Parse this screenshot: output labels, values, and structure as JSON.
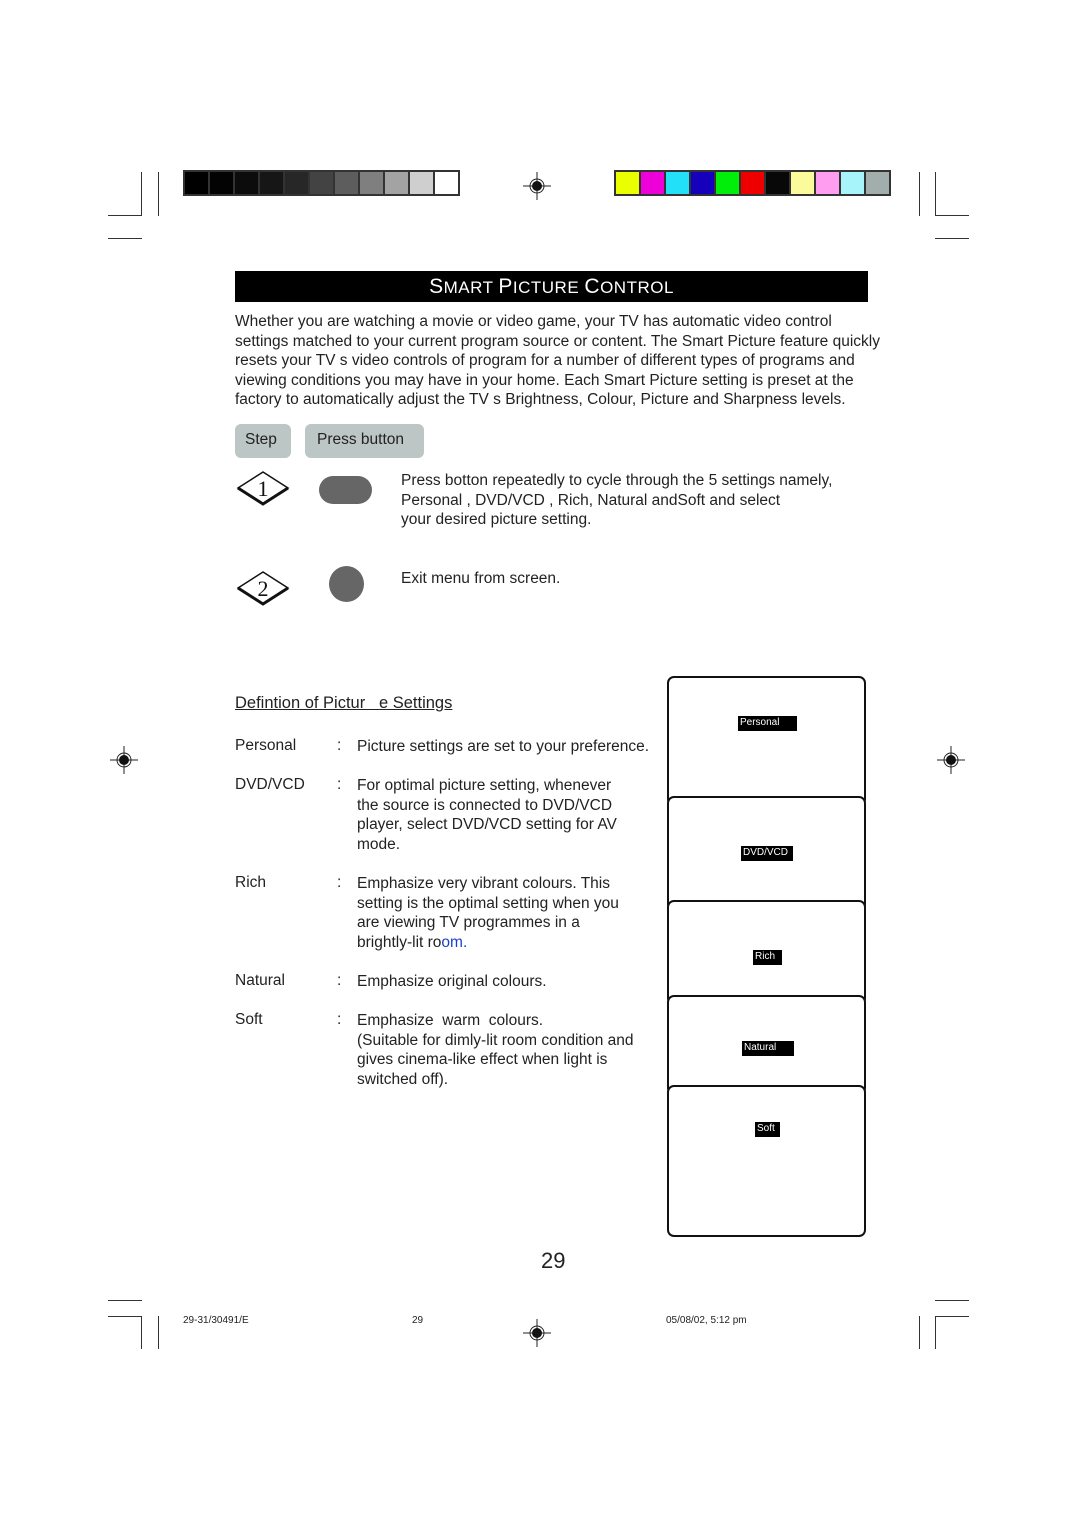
{
  "print_marks": {
    "grayscale_swatches": [
      "#000000",
      "#030303",
      "#0c0c0c",
      "#161616",
      "#272727",
      "#434343",
      "#5d5d5d",
      "#7f7f7f",
      "#a3a3a3",
      "#cfcfcf",
      "#ffffff"
    ],
    "color_swatches": [
      "#eaff00",
      "#ee00d8",
      "#22e0f8",
      "#1600bb",
      "#00ee0a",
      "#ee0000",
      "#080808",
      "#fbfb9c",
      "#ff9ef0",
      "#a8f4fb",
      "#a1aeac"
    ]
  },
  "header": {
    "title_parts": [
      {
        "big": "S",
        "small": "MART "
      },
      {
        "big": "P",
        "small": "ICTURE "
      },
      {
        "big": "C",
        "small": "ONTROL"
      }
    ]
  },
  "intro": {
    "lines": [
      "Whether you are watching a movie or video game, your TV has automatic video control",
      "settings matched to your current program source or content. The Smart Picture feature quickly",
      "resets your TV s video controls of program for a number of different types of programs and",
      "viewing conditions you may have in your home. Each Smart Picture setting is preset at the",
      "factory to automatically adjust the TV s Brightness, Colour, Picture and Sharpness levels."
    ]
  },
  "steps_header": {
    "step_label": "Step",
    "press_label": "Press button"
  },
  "steps": [
    {
      "number": "1",
      "button_icon": "oval-button",
      "lines": [
        "Press botton repeatedly to cycle through the 5 settings namely,",
        "Personal , DVD/VCD  , Rich, Natural  andSoft  and select",
        "your desired picture setting."
      ]
    },
    {
      "number": "2",
      "button_icon": "round-button",
      "lines": [
        "Exit menu from screen."
      ]
    }
  ],
  "definitions": {
    "title": "Defintion of Pictur   e Settings",
    "colon": ":",
    "items": [
      {
        "term": "Personal",
        "lines": [
          "Picture settings are set to your preference."
        ]
      },
      {
        "term": "DVD/VCD",
        "lines": [
          "For optimal picture setting, whenever",
          "the source is connected to DVD/VCD",
          "player, select DVD/VCD setting for AV",
          "mode."
        ]
      },
      {
        "term": "Rich",
        "lines": [
          "Emphasize very vibrant colours. This",
          "setting is the optimal setting when you",
          "are viewing TV programmes in a"
        ],
        "last_line_plain": "brightly-lit ro",
        "last_line_blue": "om."
      },
      {
        "term": "Natural",
        "lines": [
          "Emphasize original colours."
        ]
      },
      {
        "term": "Soft",
        "lines": [
          "Emphasize  warm  colours.",
          "(Suitable for dimly-lit room condition and",
          "gives cinema-like effect when light is",
          "switched off)."
        ]
      }
    ]
  },
  "screens": [
    "Personal",
    "DVD/VCD",
    "Rich",
    "Natural",
    "Soft"
  ],
  "page_number": "29",
  "footer": {
    "code": "29-31/30491/E",
    "page": "29",
    "timestamp": "05/08/02, 5:12 pm"
  }
}
